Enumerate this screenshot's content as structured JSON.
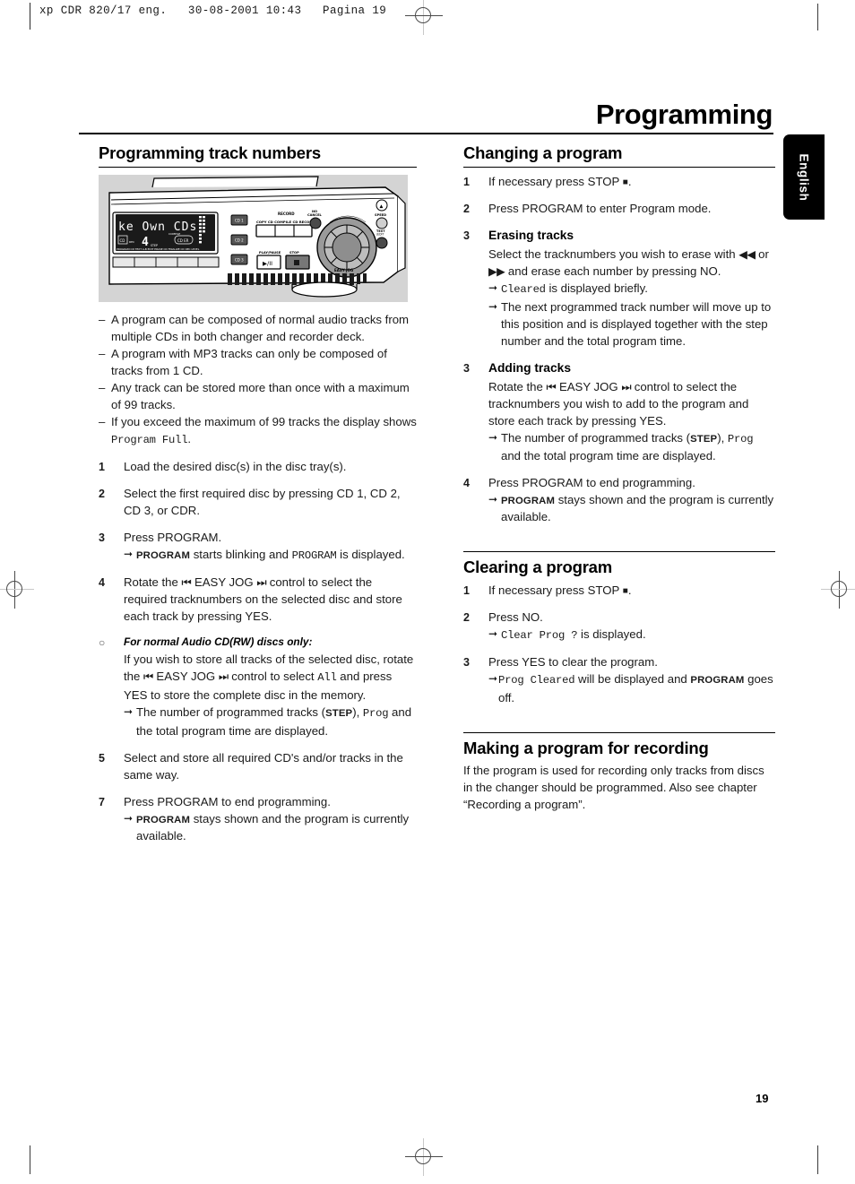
{
  "header": {
    "slug": "xp CDR 820/17 eng.   30-08-2001 10:43   Pagina 19"
  },
  "page": {
    "title": "Programming",
    "lang_tab": "English",
    "number": "19"
  },
  "left_column": {
    "section_title": "Programming track numbers",
    "device_image": {
      "name": "cd-recorder-front-panel",
      "display_text": "ke Own CDs",
      "display_track": "4",
      "buttons": [
        "CD 1",
        "CD 2",
        "CD 3"
      ],
      "record_label": "RECORD",
      "record_sub": "COPY CD COMPILE CD  RECORD",
      "play_pause_label": "PLAY/PAUSE",
      "play_pause_glyph": "▶/II",
      "stop_label": "STOP",
      "jog_label": "EASY JOG",
      "no_cancel_label": "NO CANCEL",
      "speed_label": "SPEED",
      "text_label": "TEXT/EDIT",
      "indicators": "PROGRAM  CD TEXT  A-B EDIT  ERASE CD  FINALIZE CD  REC LEVEL"
    },
    "bullets": [
      "A program can be composed of normal audio tracks from multiple CDs in both changer and recorder deck.",
      "A program with MP3 tracks can only be composed of tracks from 1 CD.",
      "Any track can be stored more than once with a maximum of 99 tracks."
    ],
    "bullet_last_pre": "If you exceed the maximum of 99 tracks the display shows ",
    "bullet_last_mono": "Program Full",
    "bullet_last_post": ".",
    "steps": [
      {
        "num": "1",
        "text": "Load the desired disc(s) in the disc tray(s)."
      },
      {
        "num": "2",
        "text": "Select the first required disc by pressing CD 1, CD 2, CD 3, or CDR."
      },
      {
        "num": "3",
        "text": "Press PROGRAM.",
        "result_caps": "PROGRAM",
        "result_pre": " starts blinking and ",
        "result_mono": "PROGRAM",
        "result_post": " is displayed."
      },
      {
        "num": "4",
        "text_a": "Rotate the ",
        "jog_left": "⏮",
        "text_b": " EASY JOG ",
        "jog_right": "⏭",
        "text_c": " control to select the required tracknumbers on the selected disc and store each track by pressing YES."
      }
    ],
    "note_head": "For normal Audio CD(RW) discs only:",
    "note_step": {
      "num": "○",
      "text_a": "If you wish to store all tracks of the selected disc, rotate the ",
      "jog_left": "⏮",
      "text_b": " EASY JOG ",
      "jog_right": "⏭",
      "text_c": " control to select ",
      "mono_all": "All",
      "text_d": " and press YES to store the complete disc in the memory.",
      "result_pre": "The number of programmed tracks (",
      "result_caps": "STEP",
      "result_mid": "), ",
      "result_mono": "Prog",
      "result_post": " and the total program time are displayed."
    },
    "steps_tail": [
      {
        "num": "5",
        "text": "Select and store all required CD's and/or tracks in the same way."
      },
      {
        "num": "7",
        "text": "Press PROGRAM to end programming.",
        "result_caps": "PROGRAM",
        "result_post": " stays shown and the program is currently available."
      }
    ]
  },
  "right_column": {
    "changing": {
      "title": "Changing a program",
      "step1": {
        "num": "1",
        "text_pre": "If necessary press STOP ",
        "glyph": "■",
        "text_post": "."
      },
      "step2": {
        "num": "2",
        "text": "Press PROGRAM to enter Program mode."
      },
      "erasing_head": "Erasing tracks",
      "erasing": {
        "num": "3",
        "text_a": "Select the tracknumbers you wish to erase with ",
        "rew": "◀◀",
        "text_b": " or ",
        "ffwd": "▶▶",
        "text_c": " and erase each number by pressing NO.",
        "res1_mono": "Cleared",
        "res1_post": " is displayed briefly.",
        "res2": "The next programmed track number will move up to this position and is displayed together with the step number and the total program time."
      },
      "adding_head": "Adding tracks",
      "adding": {
        "num": "3",
        "text_a": "Rotate the ",
        "jog_left": "⏮",
        "text_b": " EASY JOG ",
        "jog_right": "⏭",
        "text_c": " control to select the tracknumbers you wish to add to the program and store each track by pressing YES.",
        "res_pre": "The number of programmed tracks (",
        "res_caps": "STEP",
        "res_mid": "), ",
        "res_mono": "Prog",
        "res_post": " and the total program time are displayed."
      },
      "step4": {
        "num": "4",
        "text": "Press PROGRAM to end programming.",
        "result_caps": "PROGRAM",
        "result_post": " stays shown and the program is currently available."
      }
    },
    "clearing": {
      "title": "Clearing a program",
      "step1": {
        "num": "1",
        "text_pre": "If necessary press STOP ",
        "glyph": "■",
        "text_post": "."
      },
      "step2": {
        "num": "2",
        "text": "Press NO.",
        "result_mono": "Clear Prog ?",
        "result_post": " is displayed."
      },
      "step3": {
        "num": "3",
        "text": "Press YES to clear the program.",
        "result_mono": "Prog Cleared",
        "result_mid": " will be displayed and ",
        "result_caps": "PROGRAM",
        "result_post": " goes off."
      }
    },
    "recording": {
      "title": "Making a program for recording",
      "paragraph": "If the program is used for recording only tracks from discs in the changer should be programmed. Also see chapter “Recording a program”."
    }
  }
}
